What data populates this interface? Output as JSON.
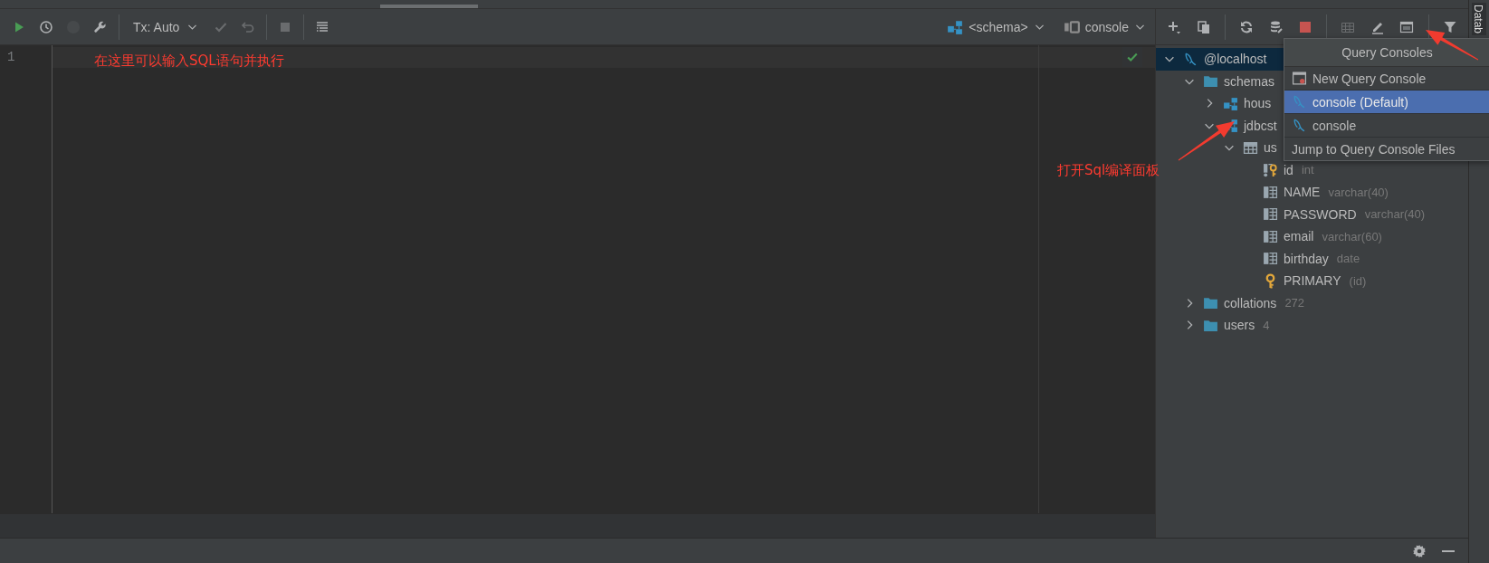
{
  "editor_toolbar": {
    "left": [
      {
        "kind": "run",
        "disabled": false
      },
      {
        "kind": "history",
        "disabled": false
      },
      {
        "kind": "profile",
        "disabled": true
      },
      {
        "kind": "wrench",
        "disabled": false
      },
      {
        "kind": "separator"
      },
      {
        "kind": "tx",
        "label": "Tx: Auto"
      },
      {
        "kind": "check",
        "disabled": true
      },
      {
        "kind": "undo",
        "disabled": true
      },
      {
        "kind": "separator"
      },
      {
        "kind": "stop",
        "disabled": true
      },
      {
        "kind": "separator"
      },
      {
        "kind": "table-view",
        "disabled": false
      }
    ],
    "right": [
      {
        "kind": "schema",
        "label": "<schema>"
      },
      {
        "kind": "console-conn",
        "label": "console"
      }
    ]
  },
  "editor": {
    "line_numbers": [
      "1"
    ]
  },
  "db_toolbar": [
    {
      "kind": "add",
      "disabled": false
    },
    {
      "kind": "copy",
      "disabled": false
    },
    {
      "kind": "separator"
    },
    {
      "kind": "refresh",
      "disabled": false
    },
    {
      "kind": "db-tool",
      "disabled": false
    },
    {
      "kind": "stop-red",
      "disabled": false
    },
    {
      "kind": "separator"
    },
    {
      "kind": "grid",
      "disabled": true
    },
    {
      "kind": "edit",
      "disabled": false
    },
    {
      "kind": "ql",
      "disabled": false
    },
    {
      "kind": "separator"
    },
    {
      "kind": "filter",
      "disabled": false
    }
  ],
  "tree": [
    {
      "kind": "mysql",
      "label": "@localhost",
      "selected": true,
      "expanded": true,
      "children": [
        {
          "kind": "folder",
          "label": "schemas",
          "selected": false,
          "expanded": true,
          "children": [
            {
              "kind": "schema",
              "label": "hous",
              "selected": false,
              "expanded": false
            },
            {
              "kind": "schema",
              "label": "jdbcst",
              "selected": false,
              "expanded": true,
              "children": [
                {
                  "kind": "table",
                  "label": "us",
                  "selected": false,
                  "expanded": true,
                  "children": [
                    {
                      "kind": "column-key",
                      "label": "id",
                      "detail": "int",
                      "selected": false
                    },
                    {
                      "kind": "column",
                      "label": "NAME",
                      "detail": "varchar(40)",
                      "selected": false
                    },
                    {
                      "kind": "column",
                      "label": "PASSWORD",
                      "detail": "varchar(40)",
                      "selected": false
                    },
                    {
                      "kind": "column",
                      "label": "email",
                      "detail": "varchar(60)",
                      "selected": false
                    },
                    {
                      "kind": "column",
                      "label": "birthday",
                      "detail": "date",
                      "selected": false
                    },
                    {
                      "kind": "key",
                      "label": "PRIMARY",
                      "detail": "(id)",
                      "selected": false
                    }
                  ]
                }
              ]
            }
          ]
        },
        {
          "kind": "folder",
          "label": "collations",
          "detail": "272",
          "selected": false,
          "expanded": false
        },
        {
          "kind": "folder",
          "label": "users",
          "detail": "4",
          "selected": false,
          "expanded": false
        }
      ]
    }
  ],
  "popup": {
    "title": "Query Consoles",
    "items": [
      {
        "kind": "new",
        "label": "New Query Console",
        "selected": false
      },
      {
        "kind": "console",
        "label": "console (Default)",
        "selected": true
      },
      {
        "kind": "console",
        "label": "console",
        "selected": false
      },
      {
        "kind": "link",
        "label": "Jump to Query Console Files",
        "selected": false
      }
    ]
  },
  "side_strip": {
    "label": "Datab"
  },
  "annotations": [
    {
      "text": "在这里可以输入SQL语句并执行"
    },
    {
      "text": "打开Sql编译面板"
    }
  ]
}
